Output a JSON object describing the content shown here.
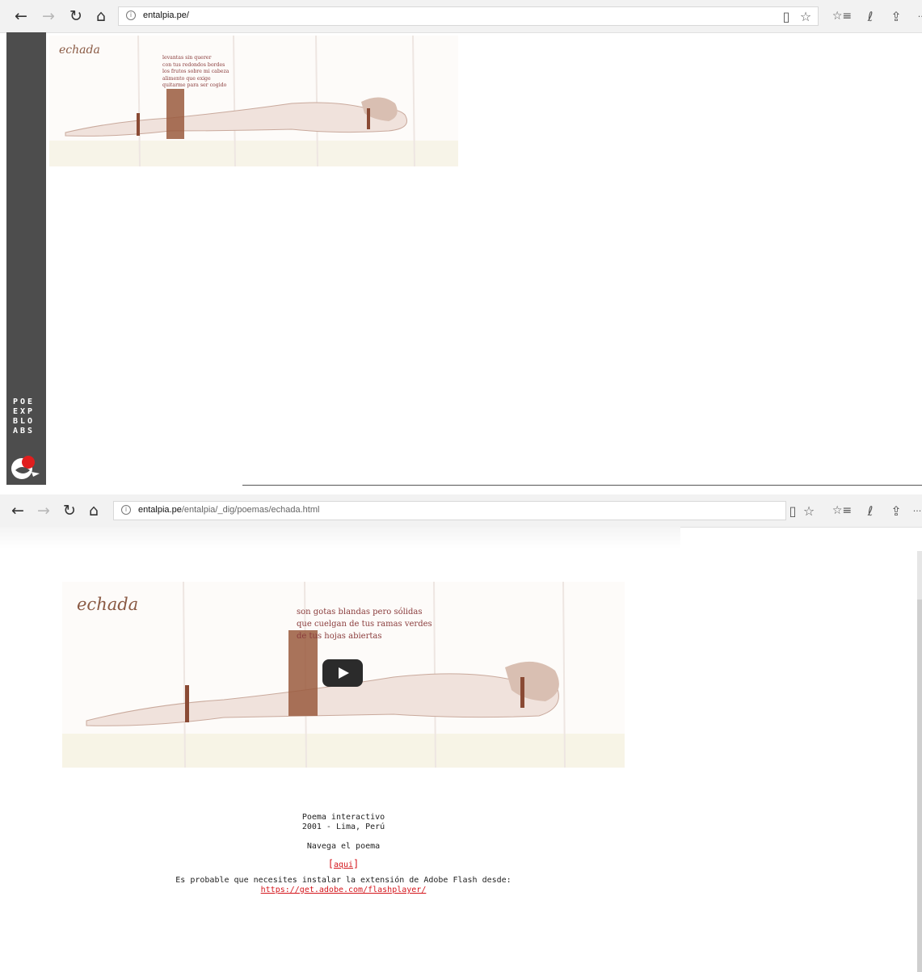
{
  "top_window": {
    "url": {
      "host": "entalpia.pe/",
      "path": ""
    },
    "banner": {
      "title": "echada",
      "poem": [
        "levantas sin querer",
        "con tus redondos bordes",
        "los frutos sobre mi cabeza",
        "alimento que exige",
        "quitarme para ser cogido"
      ]
    },
    "sidebar": {
      "wordmark": [
        "POE",
        "EXP",
        "BLO",
        "ABS"
      ]
    }
  },
  "bottom_window": {
    "url": {
      "host": "entalpia.pe",
      "path": "/entalpia/_dig/poemas/echada.html"
    },
    "banner": {
      "title": "echada",
      "poem": [
        "son gotas blandas pero sólidas",
        "que cuelgan de tus ramas verdes",
        "de tus hojas abiertas"
      ]
    },
    "info": {
      "line1": "Poema interactivo",
      "line2": "2001 - Lima, Perú",
      "navigate": "Navega el poema",
      "here_link": "aqui",
      "bracket_open": "[",
      "bracket_close": "]",
      "flash_note": "Es probable que necesites instalar la extensión de Adobe Flash desde:",
      "flash_link": "https://get.adobe.com/flashplayer/"
    }
  },
  "toolbar_icons": {
    "back": "←",
    "forward": "→",
    "refresh": "↻",
    "home": "⌂",
    "reading_view": "▯",
    "favorite": "☆",
    "favorites_hub": "☆≡",
    "pen": "ℓ",
    "share": "⇪",
    "more": "···"
  },
  "colors": {
    "sidebar": "#4d4d4d",
    "link_red": "#d4161c",
    "poem_text": "#8a3c3c"
  }
}
